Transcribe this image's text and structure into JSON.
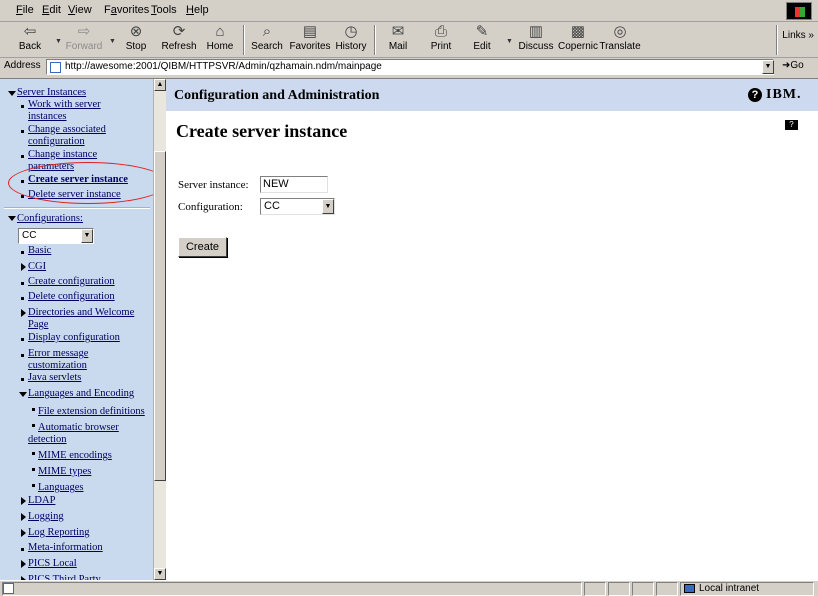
{
  "menubar": {
    "items": [
      "File",
      "Edit",
      "View",
      "Favorites",
      "Tools",
      "Help"
    ],
    "accel": [
      "F",
      "E",
      "V",
      "a",
      "T",
      "H"
    ]
  },
  "toolbar": {
    "back": "Back",
    "forward": "Forward",
    "stop": "Stop",
    "refresh": "Refresh",
    "home": "Home",
    "search": "Search",
    "favorites": "Favorites",
    "history": "History",
    "mail": "Mail",
    "print": "Print",
    "edit": "Edit",
    "discuss": "Discuss",
    "copernic": "Copernic",
    "translate": "Translate",
    "links": "Links"
  },
  "address": {
    "label": "Address",
    "url": "http://awesome:2001/QIBM/HTTPSVR/Admin/qzhamain.ndm/mainpage",
    "go": "Go"
  },
  "sidebar": {
    "server_instances": "Server Instances",
    "si_items": [
      "Work with server",
      "instances",
      "Change associated",
      "configuration",
      "Change instance",
      "parameters",
      "Create server instance",
      "Delete server instance"
    ],
    "configurations": "Configurations:",
    "config_select": "CC",
    "config_items": {
      "basic": "Basic",
      "cgi": "CGI",
      "create_config": "Create configuration",
      "delete_config": "Delete configuration",
      "dirs1": "Directories and Welcome",
      "dirs2": "Page",
      "display_config": "Display configuration",
      "err1": "Error message",
      "err2": "customization",
      "java": "Java servlets",
      "lang": "Languages and Encoding",
      "file_ext": "File extension definitions",
      "auto1": "Automatic browser",
      "auto2": "detection",
      "mime_enc": "MIME encodings",
      "mime_types": "MIME types",
      "languages": "Languages",
      "ldap": "LDAP",
      "logging": "Logging",
      "log_reporting": "Log Reporting",
      "meta": "Meta-information",
      "pics_local": "PICS Local",
      "pics_third": "PICS Third Party"
    }
  },
  "main": {
    "header": "Configuration and Administration",
    "help": "?",
    "brand": "IBM.",
    "title": "Create server instance",
    "server_label": "Server instance:",
    "server_value": "NEW",
    "config_label": "Configuration:",
    "config_value": "CC",
    "create_button": "Create"
  },
  "status": {
    "zone": "Local intranet"
  }
}
